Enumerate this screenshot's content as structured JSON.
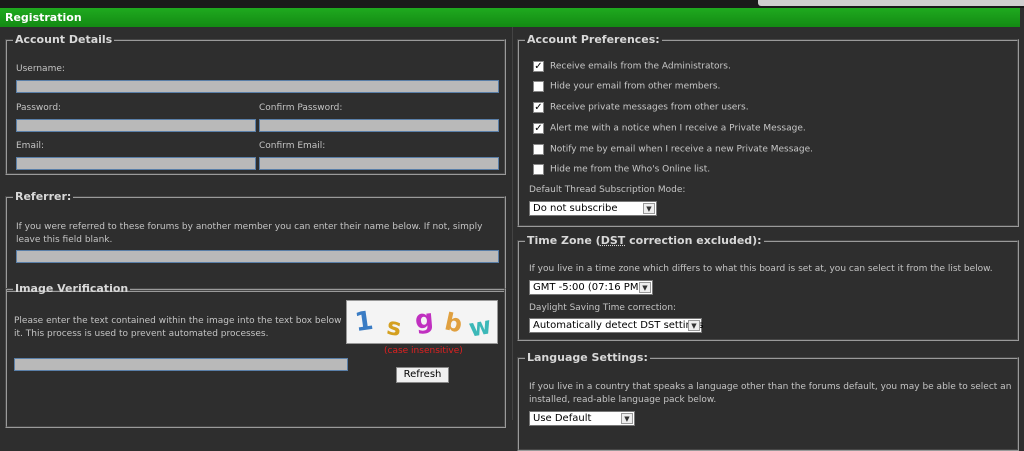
{
  "header": {
    "title": "Registration"
  },
  "account_details": {
    "legend": "Account Details",
    "username_label": "Username:",
    "password_label": "Password:",
    "confirm_password_label": "Confirm Password:",
    "email_label": "Email:",
    "confirm_email_label": "Confirm Email:"
  },
  "referrer": {
    "legend": "Referrer:",
    "description": "If you were referred to these forums by another member you can enter their name below. If not, simply leave this field blank."
  },
  "image_verification": {
    "legend": "Image Verification",
    "description": "Please enter the text contained within the image into the text box below it. This process is used to prevent automated processes.",
    "captcha_chars": [
      "1",
      "s",
      "g",
      "b",
      "w"
    ],
    "case_note": "(case insensitive)",
    "refresh_label": "Refresh"
  },
  "account_preferences": {
    "legend": "Account Preferences:",
    "options": [
      {
        "label": "Receive emails from the Administrators.",
        "checked": true
      },
      {
        "label": "Hide your email from other members.",
        "checked": false
      },
      {
        "label": "Receive private messages from other users.",
        "checked": true
      },
      {
        "label": "Alert me with a notice when I receive a Private Message.",
        "checked": true
      },
      {
        "label": "Notify me by email when I receive a new Private Message.",
        "checked": false
      },
      {
        "label": "Hide me from the Who's Online list.",
        "checked": false
      }
    ],
    "subscription_label": "Default Thread Subscription Mode:",
    "subscription_value": "Do not subscribe"
  },
  "time_zone": {
    "legend_pre": "Time Zone (",
    "legend_abbr": "DST",
    "legend_post": " correction excluded):",
    "description": "If you live in a time zone which differs to what this board is set at, you can select it from the list below.",
    "zone_value": "GMT -5:00 (07:16 PM)",
    "dst_label": "Daylight Saving Time correction:",
    "dst_value": "Automatically detect DST settings"
  },
  "language": {
    "legend": "Language Settings:",
    "description": "If you live in a country that speaks a language other than the forums default, you may be able to select an installed, read-able language pack below.",
    "value": "Use Default"
  },
  "colors": {
    "header_green": "#1a9a1a",
    "background": "#2e2e2e",
    "field_fill": "#b9b9b9",
    "case_note_red": "#e02020"
  }
}
